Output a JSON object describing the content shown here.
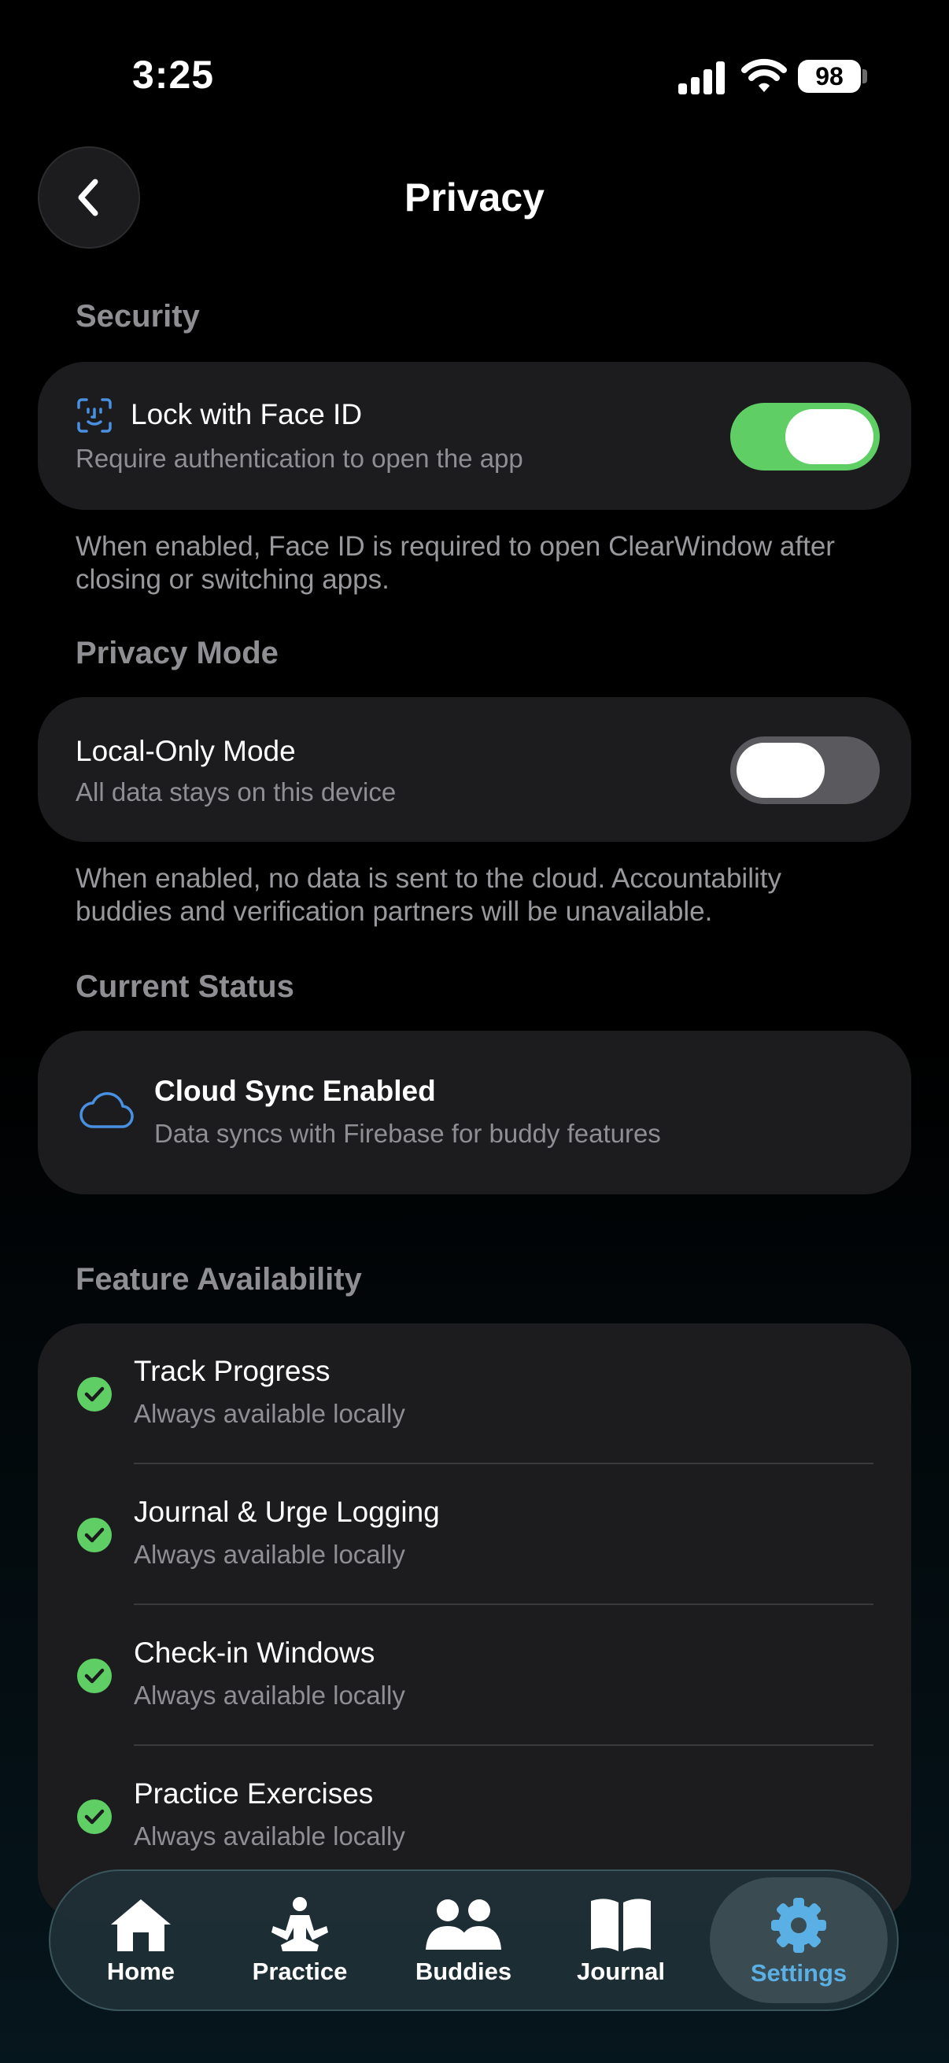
{
  "status_bar": {
    "time": "3:25",
    "battery": "98"
  },
  "header": {
    "title": "Privacy"
  },
  "security": {
    "header": "Security",
    "face_id": {
      "title": "Lock with Face ID",
      "subtitle": "Require authentication to open the app",
      "enabled": true
    },
    "footnote": "When enabled, Face ID is required to open ClearWindow after closing or switching apps."
  },
  "privacy_mode": {
    "header": "Privacy Mode",
    "local_only": {
      "title": "Local-Only Mode",
      "subtitle": "All data stays on this device",
      "enabled": false
    },
    "footnote": "When enabled, no data is sent to the cloud. Accountability buddies and verification partners will be unavailable."
  },
  "current_status": {
    "header": "Current Status",
    "title": "Cloud Sync Enabled",
    "subtitle": "Data syncs with Firebase for buddy features"
  },
  "features": {
    "header": "Feature Availability",
    "items": [
      {
        "title": "Track Progress",
        "subtitle": "Always available locally"
      },
      {
        "title": "Journal & Urge Logging",
        "subtitle": "Always available locally"
      },
      {
        "title": "Check-in Windows",
        "subtitle": "Always available locally"
      },
      {
        "title": "Practice Exercises",
        "subtitle": "Always available locally"
      }
    ]
  },
  "tabs": [
    {
      "label": "Home",
      "icon": "house-icon"
    },
    {
      "label": "Practice",
      "icon": "meditation-icon"
    },
    {
      "label": "Buddies",
      "icon": "people-icon"
    },
    {
      "label": "Journal",
      "icon": "book-icon"
    },
    {
      "label": "Settings",
      "icon": "gear-icon",
      "active": true
    }
  ],
  "colors": {
    "toggle_on": "#5fcf65",
    "toggle_off": "#59595e",
    "check": "#5fcf65",
    "accent": "#5ab0e4",
    "cloud_icon": "#4a90e2"
  }
}
